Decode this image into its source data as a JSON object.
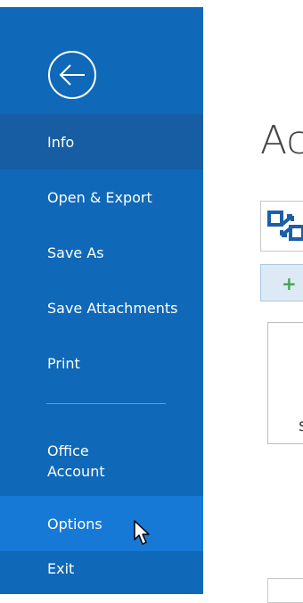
{
  "sidebar": {
    "items": [
      {
        "label": "Info",
        "state": "active"
      },
      {
        "label": "Open & Export",
        "state": "normal"
      },
      {
        "label": "Save As",
        "state": "normal"
      },
      {
        "label": "Save Attachments",
        "state": "normal"
      },
      {
        "label": "Print",
        "state": "normal"
      },
      {
        "label": "Office\nAccount",
        "state": "normal"
      },
      {
        "label": "Options",
        "state": "hover"
      },
      {
        "label": "Exit",
        "state": "normal"
      }
    ],
    "back_icon": "back-arrow-circle-icon"
  },
  "main": {
    "title_partial": "Ac",
    "account_icon": "exchange-account-icon",
    "add_icon": "plus-icon",
    "card_text_partial": "s"
  },
  "colors": {
    "sidebar": "#0f68b8",
    "active_item": "#165da3",
    "hover_item": "#1779d6",
    "plus": "#3ea64b"
  }
}
